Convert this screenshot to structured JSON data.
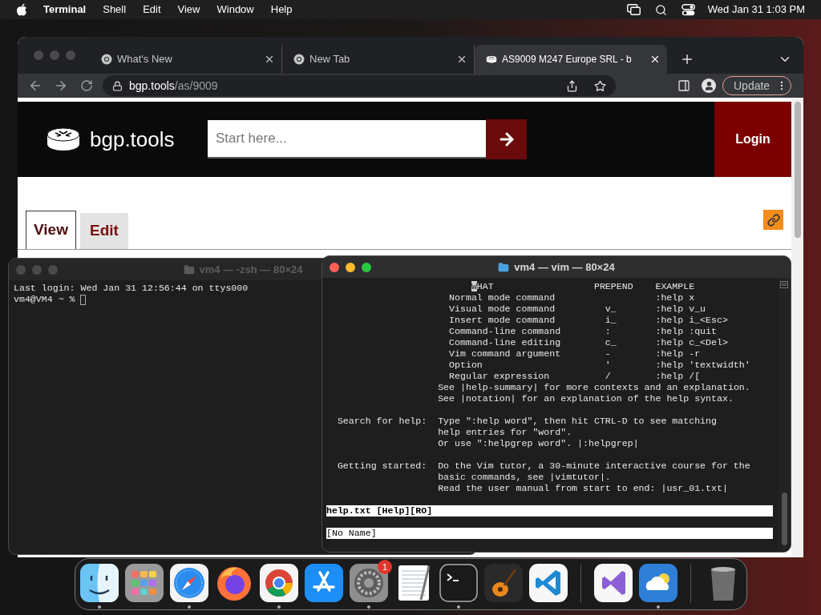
{
  "menu_bar": {
    "app_name": "Terminal",
    "menus": [
      "Shell",
      "Edit",
      "View",
      "Window",
      "Help"
    ],
    "clock": "Wed Jan 31 1:03 PM"
  },
  "browser": {
    "active": false,
    "tabs": [
      {
        "title": "What's New",
        "kind": "chrome",
        "selected": false
      },
      {
        "title": "New Tab",
        "kind": "chrome",
        "selected": false
      },
      {
        "title": "AS9009 M247 Europe SRL - b",
        "kind": "site",
        "selected": true
      }
    ],
    "address": {
      "host": "bgp.tools",
      "path": "/as/9009"
    },
    "update_label": "Update",
    "page": {
      "logo_text": "bgp.tools",
      "search_placeholder": "Start here...",
      "login_label": "Login",
      "tabs": [
        {
          "label": "View",
          "selected": true
        },
        {
          "label": "Edit",
          "selected": false
        }
      ]
    }
  },
  "terminals": [
    {
      "kind": "shell",
      "title": "vm4 — -zsh — 80×24",
      "active": false,
      "lines": [
        "Last login: Wed Jan 31 12:56:44 on ttys000"
      ],
      "prompt": "vm4@VM4 ~ %"
    },
    {
      "kind": "vim",
      "title": "vm4 — vim — 80×24",
      "active": true,
      "help": {
        "header": [
          "WHAT",
          "PREPEND",
          "EXAMPLE"
        ],
        "header_cursor": true,
        "rows": [
          {
            "what": "Normal mode command",
            "example": ":help x"
          },
          {
            "what": "Visual mode command",
            "prepend": "v_",
            "example": ":help v_u"
          },
          {
            "what": "Insert mode command",
            "prepend": "i_",
            "example": ":help i_<Esc>"
          },
          {
            "what": "Command-line command",
            "prepend": ":",
            "example": ":help :quit"
          },
          {
            "what": "Command-line editing",
            "prepend": "c_",
            "example": ":help c_<Del>"
          },
          {
            "what": "Vim command argument",
            "prepend": "-",
            "example": ":help -r"
          },
          {
            "what": "Option",
            "prepend": "'",
            "example": ":help 'textwidth'"
          },
          {
            "what": "Regular expression",
            "prepend": "/",
            "example": ":help /["
          }
        ],
        "notes": [
          "See |help-summary| for more contexts and an explanation.",
          "See |notation| for an explanation of the help syntax."
        ],
        "sections": [
          {
            "label": "Search for help:",
            "lines": [
              "Type \":help word\", then hit CTRL-D to see matching",
              "help entries for \"word\".",
              "Or use \":helpgrep word\". |:helpgrep|"
            ]
          },
          {
            "label": "Getting started:",
            "lines": [
              "Do the Vim tutor, a 30-minute interactive course for the",
              "basic commands, see |vimtutor|.",
              "Read the user manual from start to end: |usr_01.txt|"
            ]
          }
        ]
      },
      "status_lines": [
        {
          "text": "help.txt [Help][RO]",
          "current": true
        },
        {
          "text": "[No Name]",
          "current": false
        }
      ]
    }
  ],
  "dock": {
    "groups": [
      [
        {
          "kind": "finder",
          "running": true
        },
        {
          "kind": "launchpad",
          "running": false
        },
        {
          "kind": "safari",
          "running": true
        },
        {
          "kind": "firefox",
          "running": false
        },
        {
          "kind": "chrome",
          "running": true
        },
        {
          "kind": "app_store",
          "running": false
        },
        {
          "kind": "settings",
          "running": true,
          "badge": "1"
        },
        {
          "kind": "textedit",
          "running": false
        },
        {
          "kind": "terminal",
          "running": true
        },
        {
          "kind": "garageband",
          "running": false
        },
        {
          "kind": "vscode",
          "running": false
        }
      ],
      [
        {
          "kind": "visual_studio",
          "running": false
        },
        {
          "kind": "weather",
          "running": true
        }
      ],
      [
        {
          "kind": "trash",
          "running": false
        }
      ]
    ]
  }
}
